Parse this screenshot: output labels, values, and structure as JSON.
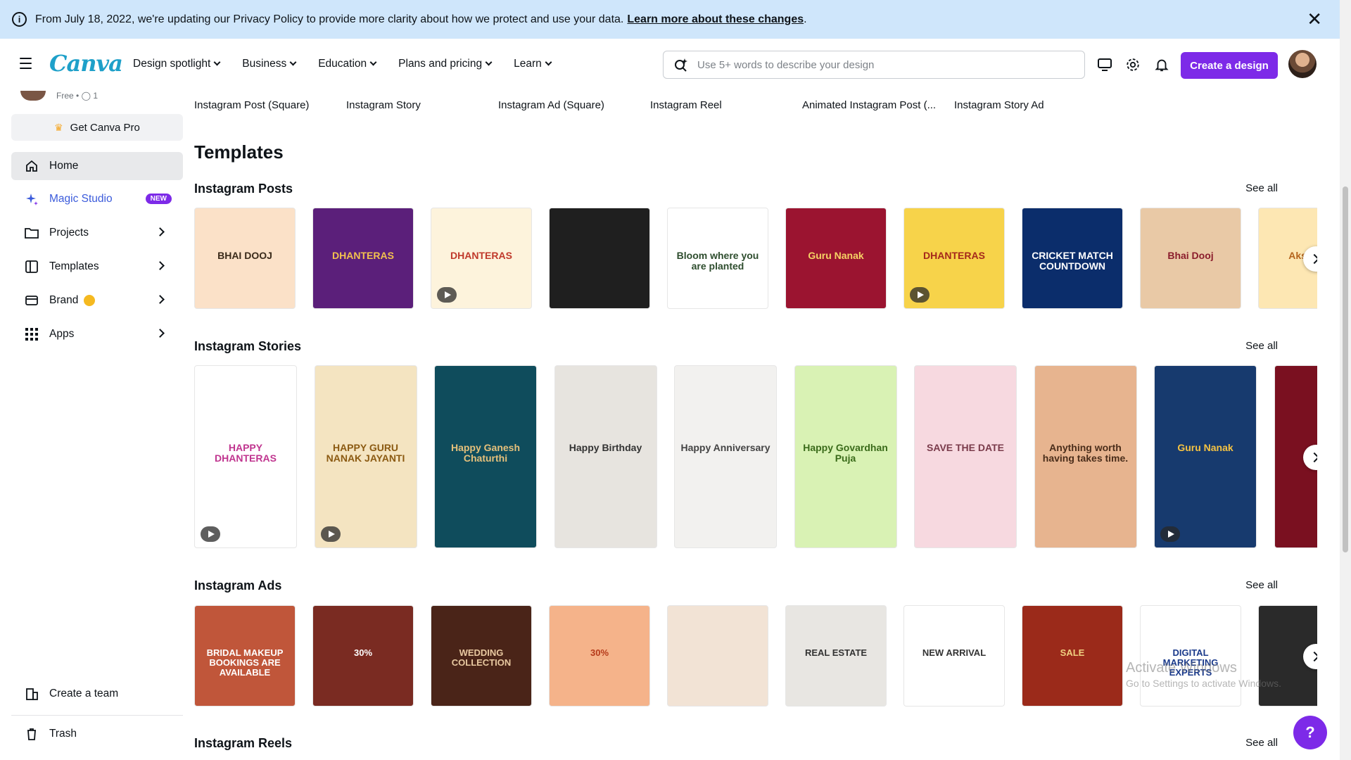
{
  "banner": {
    "text": "From July 18, 2022, we're updating our Privacy Policy to provide more clarity about how we protect and use your data.",
    "link": "Learn more about these changes"
  },
  "header": {
    "logo": "Canva",
    "nav": [
      "Design spotlight",
      "Business",
      "Education",
      "Plans and pricing",
      "Learn"
    ],
    "search_placeholder": "Use 5+ words to describe your design",
    "create_button": "Create a design"
  },
  "sidebar": {
    "plan": "Free •",
    "members": "1",
    "get_pro": "Get Canva Pro",
    "items": [
      {
        "label": "Home"
      },
      {
        "label": "Magic Studio",
        "badge": "NEW"
      },
      {
        "label": "Projects"
      },
      {
        "label": "Templates"
      },
      {
        "label": "Brand"
      },
      {
        "label": "Apps"
      }
    ],
    "create_team": "Create a team",
    "trash": "Trash"
  },
  "top_types": [
    "Instagram Post (Square)",
    "Instagram Story",
    "Instagram Ad (Square)",
    "Instagram Reel",
    "Animated Instagram Post (...",
    "Instagram Story Ad"
  ],
  "templates_title": "Templates",
  "see_all": "See all",
  "sections": {
    "posts": {
      "title": "Instagram Posts",
      "cards": [
        {
          "text": "BHAI DOOJ",
          "bg": "#fbe1c8",
          "fg": "#3a2a1a"
        },
        {
          "text": "DHANTERAS",
          "bg": "#5b1f7a",
          "fg": "#f2c14e"
        },
        {
          "text": "DHANTERAS",
          "bg": "#fdf3dc",
          "fg": "#c0392b"
        },
        {
          "text": "",
          "bg": "#1f1f1f",
          "fg": "#d4af37"
        },
        {
          "text": "Bloom where you are planted",
          "bg": "#ffffff",
          "fg": "#2e4d2e"
        },
        {
          "text": "Guru Nanak",
          "bg": "#9b1430",
          "fg": "#f6d365"
        },
        {
          "text": "DHANTERAS",
          "bg": "#f7d34a",
          "fg": "#a5281b"
        },
        {
          "text": "CRICKET MATCH COUNTDOWN",
          "bg": "#0b2d6b",
          "fg": "#ffffff"
        },
        {
          "text": "Bhai Dooj",
          "bg": "#e9c9a6",
          "fg": "#8b1d2c"
        },
        {
          "text": "Akshaya",
          "bg": "#fde7b3",
          "fg": "#b5651d"
        }
      ]
    },
    "stories": {
      "title": "Instagram Stories",
      "cards": [
        {
          "text": "HAPPY DHANTERAS",
          "bg": "#ffffff",
          "fg": "#c0358f"
        },
        {
          "text": "HAPPY GURU NANAK JAYANTI",
          "bg": "#f4e4c1",
          "fg": "#8b5a12"
        },
        {
          "text": "Happy Ganesh Chaturthi",
          "bg": "#0f4c5c",
          "fg": "#e5c07b"
        },
        {
          "text": "Happy Birthday",
          "bg": "#e7e4df",
          "fg": "#333333"
        },
        {
          "text": "Happy Anniversary",
          "bg": "#f2f1ef",
          "fg": "#444444"
        },
        {
          "text": "Happy Govardhan Puja",
          "bg": "#d9f2b4",
          "fg": "#3a6b1a"
        },
        {
          "text": "SAVE THE DATE",
          "bg": "#f7d9e0",
          "fg": "#7a3b4b"
        },
        {
          "text": "Anything worth having takes time.",
          "bg": "#e7b48f",
          "fg": "#4a2d1a"
        },
        {
          "text": "Guru Nanak",
          "bg": "#173a6e",
          "fg": "#f6c342"
        },
        {
          "text": "",
          "bg": "#7a1020",
          "fg": "#f0c060"
        }
      ]
    },
    "ads": {
      "title": "Instagram Ads",
      "cards": [
        {
          "text": "BRIDAL MAKEUP BOOKINGS ARE AVAILABLE",
          "bg": "#c0563a",
          "fg": "#ffffff"
        },
        {
          "text": "30%",
          "bg": "#7a2b22",
          "fg": "#ffffff"
        },
        {
          "text": "WEDDING COLLECTION",
          "bg": "#4a2418",
          "fg": "#e8c8a0"
        },
        {
          "text": "30%",
          "bg": "#f5b38a",
          "fg": "#b53a1a"
        },
        {
          "text": "",
          "bg": "#f2e3d5",
          "fg": "#6b3a1a"
        },
        {
          "text": "REAL ESTATE",
          "bg": "#e8e6e2",
          "fg": "#333333"
        },
        {
          "text": "NEW ARRIVAL",
          "bg": "#ffffff",
          "fg": "#333333"
        },
        {
          "text": "SALE",
          "bg": "#9b2a1a",
          "fg": "#f0d080"
        },
        {
          "text": "DIGITAL MARKETING EXPERTS",
          "bg": "#ffffff",
          "fg": "#1a3a8b"
        },
        {
          "text": "",
          "bg": "#2a2a2a",
          "fg": "#f0c060"
        }
      ]
    },
    "reels": {
      "title": "Instagram Reels"
    }
  },
  "watermark": {
    "line1": "Activate Windows",
    "line2": "Go to Settings to activate Windows."
  },
  "help": "?"
}
